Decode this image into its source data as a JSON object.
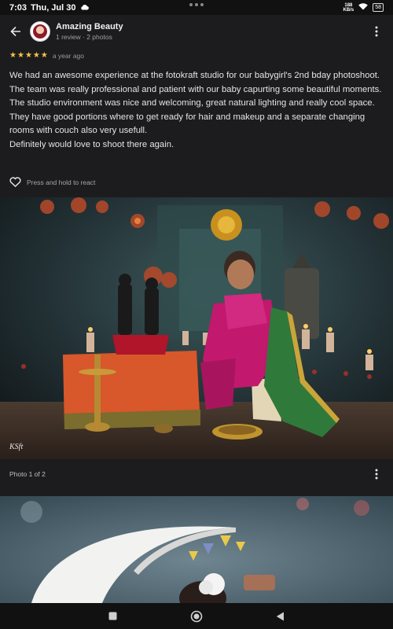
{
  "status_bar": {
    "time": "7:03",
    "date": "Thu, Jul 30",
    "net_speed_value": "188",
    "net_speed_unit": "KB/s",
    "battery": "58"
  },
  "header": {
    "reviewer_name": "Amazing Beauty",
    "reviewer_stats": "1 review · 2 photos",
    "avatar_icon": "profile-avatar"
  },
  "review": {
    "rating": 5,
    "stars": [
      "★",
      "★",
      "★",
      "★",
      "★"
    ],
    "time_ago": "a year ago",
    "paragraphs": [
      "We had an awesome experience at the fotokraft studio for our babygirl's 2nd bday photoshoot. The team was really professional and patient with our baby capurting some beautiful moments.",
      "The studio environment was nice and welcoming, great natural lighting and really cool space. They have good portions where to get ready for hair and makeup and a separate changing rooms with couch also very usefull.",
      "Definitely would love to shoot there again."
    ],
    "react_label": "Press and hold to react"
  },
  "photos": {
    "photo1_watermark": "KSft",
    "caption": "Photo 1 of 2"
  },
  "colors": {
    "background": "#1c1c1e",
    "star": "#f6c344",
    "text": "#e4e4e4",
    "muted": "#a0a0a0"
  }
}
